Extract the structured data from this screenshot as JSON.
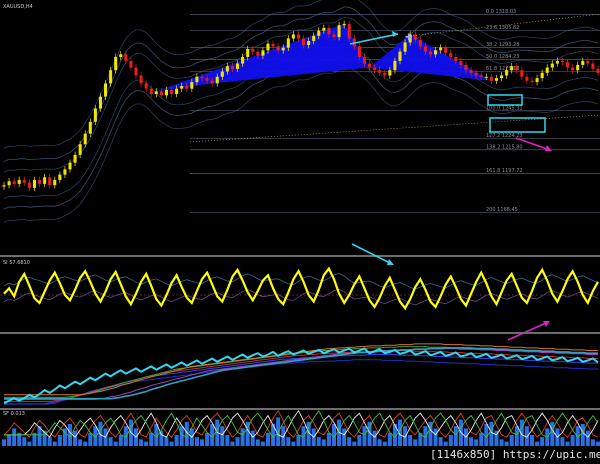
{
  "chart_data": [
    {
      "type": "line",
      "name": "price",
      "title": "XAUUSD,H4",
      "x_count": 118,
      "close": [
        1189,
        1192,
        1190,
        1193,
        1191,
        1187,
        1193,
        1190,
        1195,
        1189,
        1193,
        1197,
        1201,
        1206,
        1212,
        1220,
        1228,
        1237,
        1247,
        1256,
        1266,
        1276,
        1286,
        1288,
        1283,
        1278,
        1272,
        1266,
        1262,
        1258,
        1260,
        1257,
        1261,
        1258,
        1262,
        1264,
        1262,
        1267,
        1271,
        1270,
        1268,
        1266,
        1271,
        1275,
        1279,
        1277,
        1281,
        1286,
        1292,
        1290,
        1287,
        1291,
        1296,
        1294,
        1291,
        1293,
        1300,
        1303,
        1300,
        1295,
        1298,
        1302,
        1306,
        1308,
        1303,
        1301,
        1310,
        1311,
        1300,
        1294,
        1286,
        1281,
        1278,
        1276,
        1274,
        1272,
        1276,
        1283,
        1290,
        1297,
        1303,
        1299,
        1294,
        1290,
        1288,
        1291,
        1293,
        1289,
        1286,
        1283,
        1280,
        1276,
        1274,
        1272,
        1271,
        1271,
        1268,
        1270,
        1272,
        1276,
        1279,
        1276,
        1271,
        1268,
        1267,
        1270,
        1274,
        1278,
        1281,
        1283,
        1282,
        1278,
        1276,
        1280,
        1283,
        1281,
        1277,
        1274
      ],
      "ylim": [
        1140,
        1320
      ]
    },
    {
      "type": "line",
      "name": "fibonacci_levels",
      "levels": [
        {
          "label": "0.0  1318.03",
          "ratio": 0.0,
          "value": 1318.03
        },
        {
          "label": "23.6  1305.82",
          "ratio": 0.236,
          "value": 1305.82
        },
        {
          "label": "38.2  1293.28",
          "ratio": 0.382,
          "value": 1293.28
        },
        {
          "label": "50.0  1284.23",
          "ratio": 0.5,
          "value": 1284.23
        },
        {
          "label": "61.8  1275.18",
          "ratio": 0.618,
          "value": 1275.18
        },
        {
          "label": "100.0  1245.31",
          "ratio": 1.0,
          "value": 1245.31
        },
        {
          "label": "127.2  1224.23",
          "ratio": 1.272,
          "value": 1224.23
        },
        {
          "label": "138.2  1215.80",
          "ratio": 1.382,
          "value": 1215.8
        },
        {
          "label": "161.8  1197.72",
          "ratio": 1.618,
          "value": 1197.72
        },
        {
          "label": "200  1168.45",
          "ratio": 2.0,
          "value": 1168.45
        }
      ]
    },
    {
      "type": "line",
      "name": "oscillator",
      "title": "SI 57.6810",
      "ylim": [
        0,
        100
      ],
      "values": [
        52,
        60,
        48,
        70,
        82,
        64,
        45,
        38,
        55,
        72,
        84,
        68,
        50,
        42,
        58,
        76,
        86,
        70,
        52,
        40,
        55,
        74,
        85,
        66,
        48,
        36,
        52,
        70,
        82,
        64,
        44,
        34,
        50,
        68,
        80,
        62,
        46,
        38,
        56,
        74,
        84,
        66,
        48,
        40,
        58,
        78,
        88,
        72,
        54,
        42,
        56,
        72,
        80,
        60,
        44,
        36,
        54,
        74,
        86,
        70,
        50,
        40,
        58,
        80,
        90,
        74,
        52,
        38,
        50,
        66,
        78,
        60,
        42,
        32,
        46,
        64,
        76,
        58,
        40,
        30,
        44,
        62,
        74,
        58,
        40,
        32,
        48,
        66,
        78,
        62,
        44,
        34,
        52,
        70,
        84,
        68,
        48,
        36,
        54,
        72,
        82,
        64,
        46,
        38,
        56,
        76,
        88,
        72,
        52,
        40,
        56,
        74,
        86,
        70,
        50,
        38,
        56,
        70
      ]
    },
    {
      "type": "line",
      "name": "trend_lines",
      "ylim": [
        0,
        100
      ],
      "values": [
        8,
        9,
        10,
        12,
        13,
        15,
        17,
        19,
        22,
        24,
        26,
        29,
        31,
        33,
        35,
        37,
        39,
        41,
        43,
        45,
        47,
        49,
        51,
        52,
        53,
        54,
        55,
        56,
        57,
        58,
        59,
        60,
        61,
        62,
        63,
        64,
        65,
        66,
        67,
        68,
        69,
        70,
        71,
        72,
        73,
        74,
        75,
        76,
        77,
        78,
        78,
        79,
        79,
        80,
        80,
        81,
        81,
        82,
        82,
        82,
        83,
        83,
        83,
        84,
        84,
        84,
        85,
        85,
        85,
        85,
        85,
        85,
        84,
        84,
        84,
        84,
        83,
        83,
        83,
        82,
        82,
        82,
        81,
        81,
        81,
        80,
        80,
        80,
        79,
        79,
        79,
        78,
        78,
        78,
        77,
        77,
        77,
        76,
        76,
        76,
        75,
        75,
        75,
        74,
        74,
        74,
        73,
        73,
        73,
        72,
        72,
        72,
        71,
        71,
        71,
        70,
        70,
        70
      ]
    },
    {
      "type": "bar",
      "name": "histogram",
      "title": "SF 0.013",
      "values": [
        3,
        5,
        8,
        6,
        4,
        2,
        6,
        9,
        7,
        4,
        2,
        5,
        8,
        10,
        7,
        3,
        2,
        6,
        9,
        11,
        8,
        4,
        2,
        5,
        9,
        12,
        8,
        3,
        2,
        6,
        10,
        7,
        4,
        2,
        5,
        9,
        11,
        8,
        4,
        3,
        6,
        10,
        12,
        9,
        5,
        2,
        4,
        8,
        11,
        7,
        3,
        2,
        6,
        10,
        13,
        9,
        4,
        2,
        5,
        9,
        11,
        8,
        4,
        3,
        6,
        10,
        12,
        8,
        4,
        2,
        5,
        9,
        11,
        7,
        3,
        2,
        6,
        10,
        12,
        9,
        5,
        3,
        6,
        9,
        11,
        8,
        4,
        2,
        5,
        9,
        12,
        8,
        4,
        3,
        6,
        10,
        11,
        7,
        3,
        2,
        5,
        9,
        12,
        9,
        5,
        2,
        4,
        8,
        11,
        8,
        4,
        2,
        5,
        9,
        10,
        7,
        3,
        2
      ]
    }
  ],
  "watermark": "[1146x850] https://upic.me/",
  "colors": {
    "bull": "#f2e600",
    "bear": "#e8201a",
    "pattern": "#1010f0",
    "cyan": "#33d6f0",
    "magenta": "#e020c8",
    "osc": "#ffff00"
  }
}
